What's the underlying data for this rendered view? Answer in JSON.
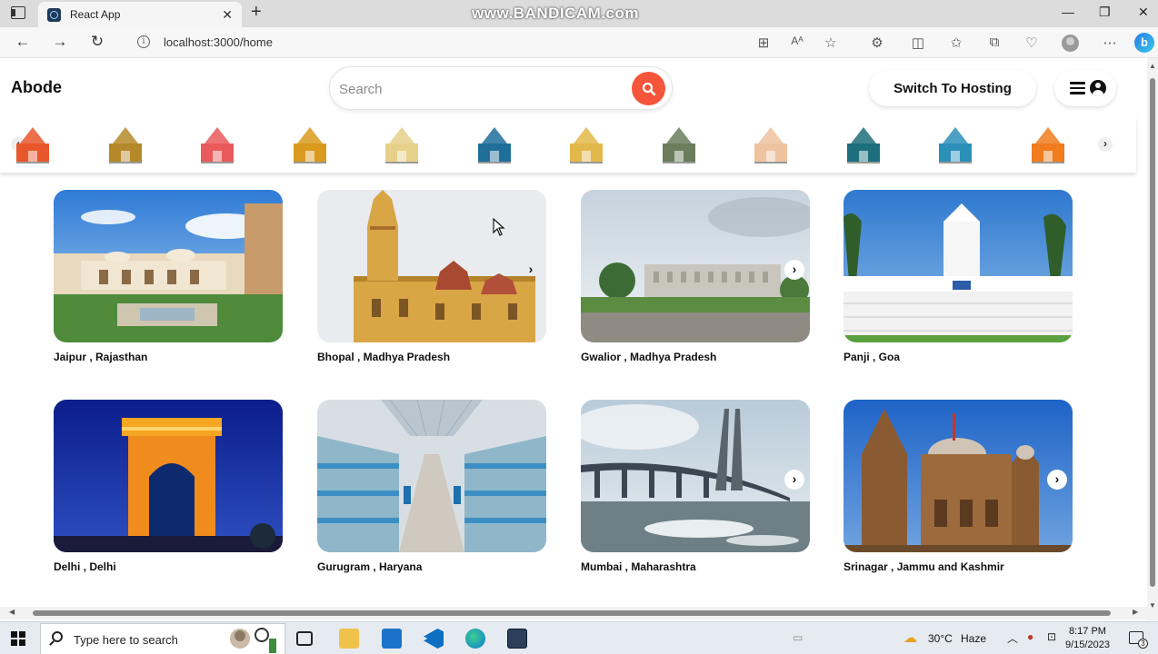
{
  "browser": {
    "tab_title": "React App",
    "url": "localhost:3000/home",
    "watermark": "www.BANDICAM.com"
  },
  "app": {
    "logo": "Abode",
    "search_placeholder": "Search",
    "switch_button": "Switch To Hosting"
  },
  "categories": [
    {
      "name": "fort-icon",
      "color": "#e8572b"
    },
    {
      "name": "palace-icon",
      "color": "#b5892a"
    },
    {
      "name": "beach-icon",
      "color": "#e95a5a"
    },
    {
      "name": "gate-icon",
      "color": "#d99a1e"
    },
    {
      "name": "taj-icon",
      "color": "#e7d08a"
    },
    {
      "name": "mountain-icon",
      "color": "#1f6f9a"
    },
    {
      "name": "church-icon",
      "color": "#e3b84b"
    },
    {
      "name": "cave-icon",
      "color": "#6a7d5c"
    },
    {
      "name": "temple-icon",
      "color": "#efc2a0"
    },
    {
      "name": "garden-icon",
      "color": "#1d6f7d"
    },
    {
      "name": "cottage-icon",
      "color": "#2c8fb8"
    },
    {
      "name": "pagoda-icon",
      "color": "#f07c1e"
    }
  ],
  "listings": [
    {
      "title": "Jaipur , Rajasthan"
    },
    {
      "title": "Bhopal , Madhya Pradesh"
    },
    {
      "title": "Gwalior , Madhya Pradesh"
    },
    {
      "title": "Panji , Goa"
    },
    {
      "title": "Delhi , Delhi"
    },
    {
      "title": "Gurugram , Haryana"
    },
    {
      "title": "Mumbai , Maharashtra"
    },
    {
      "title": "Srinagar , Jammu and Kashmir"
    }
  ],
  "taskbar": {
    "search_placeholder": "Type here to search",
    "weather_temp": "30°C",
    "weather_desc": "Haze",
    "time": "8:17 PM",
    "date": "9/15/2023",
    "notification_count": "3"
  },
  "theme": {
    "accent": "#f5553a"
  }
}
